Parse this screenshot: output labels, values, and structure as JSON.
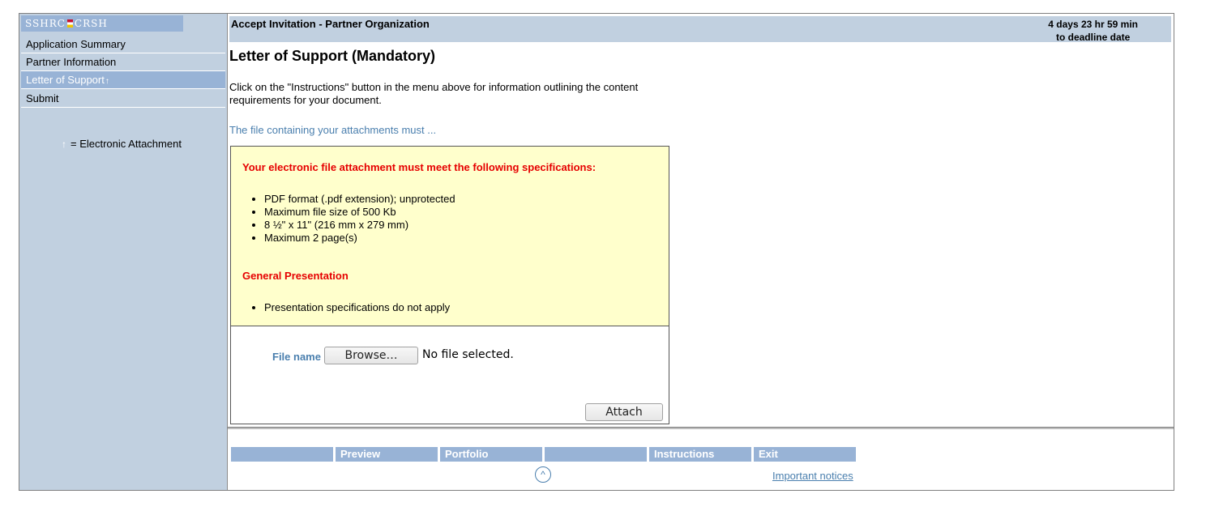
{
  "sidebar": {
    "logo_left": "SSHRC",
    "logo_right": "CRSH",
    "items": [
      {
        "label": "Application Summary"
      },
      {
        "label": "Partner Information"
      },
      {
        "label": "Letter of Support"
      },
      {
        "label": "Submit"
      }
    ],
    "attachment_marker": "↑",
    "legend_text": "= Electronic Attachment"
  },
  "header": {
    "title": "Accept Invitation - Partner Organization",
    "deadline_line1": "4 days 23 hr 59 min",
    "deadline_line2": "to deadline date"
  },
  "main": {
    "section_title": "Letter of Support (Mandatory)",
    "instructions_text": "Click on the \"Instructions\" button in the menu above for information outlining the content requirements for your document.",
    "must_link": "The file containing your attachments must ...",
    "spec_heading": "Your electronic file attachment must meet the following specifications:",
    "spec_items": [
      "PDF format (.pdf extension); unprotected",
      "Maximum file size of 500 Kb",
      "8 ½\" x 11\" (216 mm x 279 mm)",
      "Maximum 2 page(s)"
    ],
    "general_heading": "General Presentation",
    "general_items": [
      "Presentation specifications do not apply"
    ],
    "file_label": "File name",
    "browse_label": "Browse…",
    "no_file_text": "No file selected.",
    "attach_label": "Attach"
  },
  "footer": {
    "menu": [
      "",
      "Preview",
      "Portfolio",
      "",
      "Instructions",
      "Exit"
    ],
    "top_symbol": "^",
    "notices_link": "Important notices"
  },
  "colors": {
    "sidebar_bg": "#c1d0e0",
    "accent": "#98b3d6",
    "spec_bg": "#ffffcc",
    "spec_heading": "#e60000",
    "link": "#4a7fae"
  }
}
